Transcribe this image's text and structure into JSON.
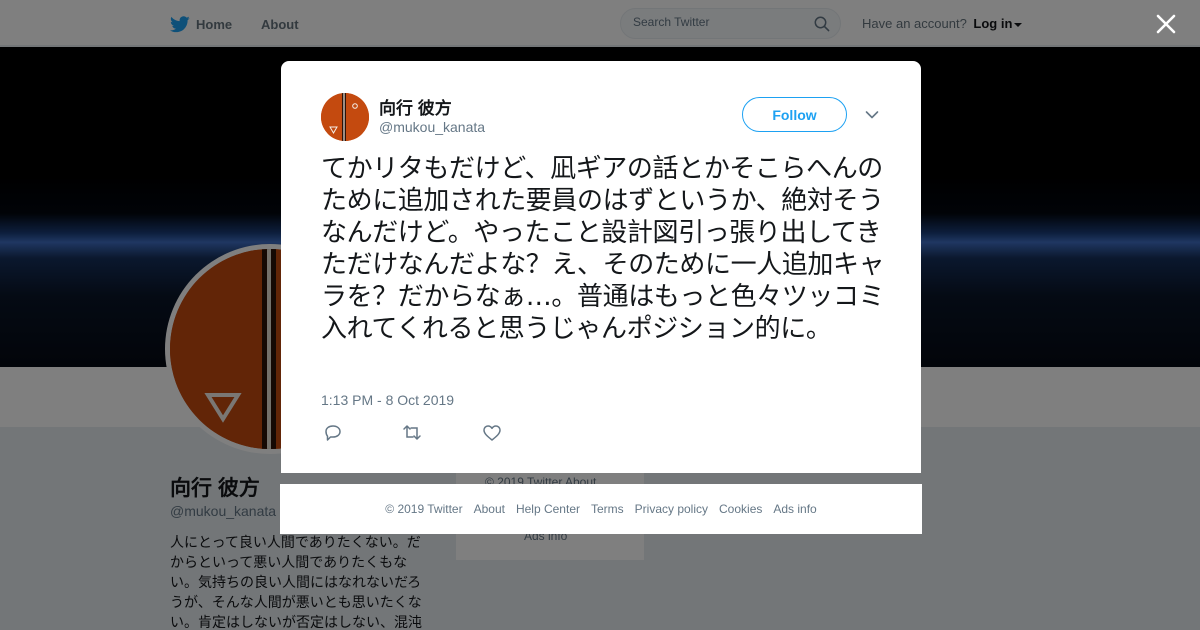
{
  "nav": {
    "home": "Home",
    "about": "About",
    "search_placeholder": "Search Twitter",
    "account_prompt": "Have an account?",
    "login": "Log in"
  },
  "profile": {
    "name": "向行 彼方",
    "handle": "@mukou_kanata",
    "bio": "人にとって良い人間でありたくない。だからといって悪い人間でありたくもない。気持ちの良い人間にはなれないだろうが、そんな人間が悪いとも思いたくない。肯定はしないが否定はしない、混沌"
  },
  "side_card": {
    "line1": "© 2019 Twitter   About",
    "line2": "Ads info"
  },
  "tweet": {
    "author_name": "向行 彼方",
    "author_handle": "@mukou_kanata",
    "follow_label": "Follow",
    "text": "てかリタもだけど、凪ギアの話とかそこらへんのために追加された要員のはずというか、絶対そうなんだけど。やったこと設計図引っ張り出してきただけなんだよな？え、そのために一人追加キャラを？だからなぁ…。普通はもっと色々ツッコミ入れてくれると思うじゃんポジション的に。",
    "timestamp": "1:13 PM - 8 Oct 2019"
  },
  "footer": {
    "copyright": "© 2019 Twitter",
    "about": "About",
    "help": "Help Center",
    "terms": "Terms",
    "privacy": "Privacy policy",
    "cookies": "Cookies",
    "ads": "Ads info"
  },
  "icons": {
    "logo": "twitter-bird-icon",
    "search": "search-icon",
    "close": "close-icon",
    "chevron": "chevron-down-icon",
    "reply": "reply-icon",
    "retweet": "retweet-icon",
    "like": "heart-icon"
  },
  "colors": {
    "brand": "#1da1f2",
    "text": "#14171a",
    "muted": "#657786",
    "avatar": "#c44a0f"
  }
}
